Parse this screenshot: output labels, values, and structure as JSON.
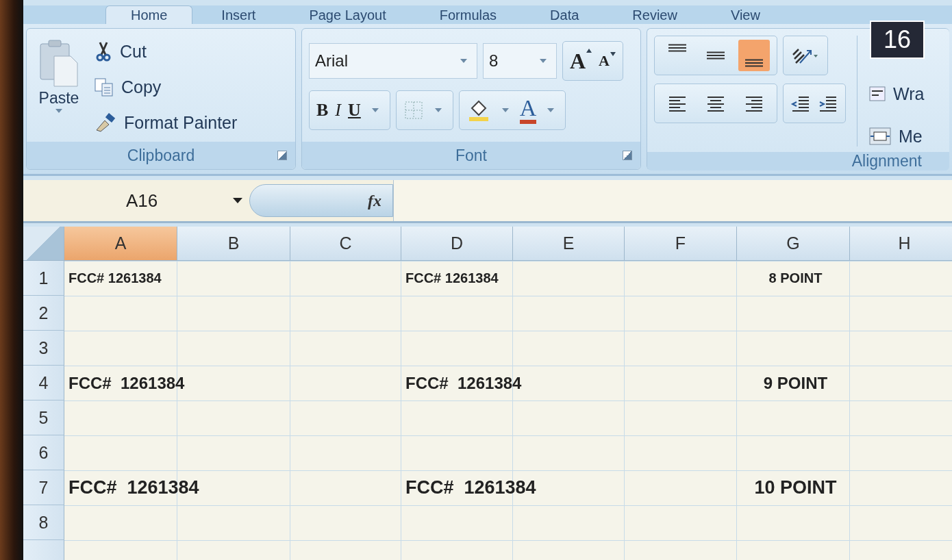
{
  "ribbon": {
    "tabs": [
      {
        "label": "Home",
        "selected": true
      },
      {
        "label": "Insert",
        "selected": false
      },
      {
        "label": "Page Layout",
        "selected": false
      },
      {
        "label": "Formulas",
        "selected": false
      },
      {
        "label": "Data",
        "selected": false
      },
      {
        "label": "Review",
        "selected": false
      },
      {
        "label": "View",
        "selected": false
      }
    ],
    "clipboard": {
      "label": "Clipboard",
      "paste": "Paste",
      "items": [
        {
          "kind": "cut",
          "label": "Cut"
        },
        {
          "kind": "copy",
          "label": "Copy"
        },
        {
          "kind": "painter",
          "label": "Format Painter"
        }
      ]
    },
    "font": {
      "label": "Font",
      "font_name": "Arial",
      "font_size": "8",
      "grow": "A",
      "shrink": "A",
      "bold": "B",
      "italic": "I",
      "underline": "U",
      "font_color": "A"
    },
    "alignment": {
      "label": "Alignment",
      "vertical": [
        {
          "kind": "top",
          "selected": false
        },
        {
          "kind": "middle",
          "selected": false
        },
        {
          "kind": "bottom",
          "selected": true
        }
      ],
      "horizontal": [
        {
          "kind": "left"
        },
        {
          "kind": "center"
        },
        {
          "kind": "right"
        }
      ],
      "wrap_text": "Wra",
      "merge": "Me"
    }
  },
  "formula_bar": {
    "name_box": "A16",
    "fx": "fx"
  },
  "sheet": {
    "columns": [
      {
        "label": "A",
        "selected": true
      },
      {
        "label": "B",
        "selected": false
      },
      {
        "label": "C",
        "selected": false
      },
      {
        "label": "D",
        "selected": false
      },
      {
        "label": "E",
        "selected": false
      },
      {
        "label": "F",
        "selected": false
      },
      {
        "label": "G",
        "selected": false
      },
      {
        "label": "H",
        "selected": false
      }
    ],
    "rows": [
      {
        "label": "1",
        "cells": {
          "A": {
            "text": "FCC# 1261384",
            "kind": "spill"
          },
          "D": {
            "text": "FCC# 1261384",
            "kind": "spill"
          },
          "G": {
            "text": "8 POINT",
            "kind": "centered"
          }
        }
      },
      {
        "label": "2"
      },
      {
        "label": "3"
      },
      {
        "label": "4",
        "cells": {
          "A": {
            "text": "FCC#  1261384",
            "kind": "spill"
          },
          "D": {
            "text": "FCC#  1261384",
            "kind": "spill"
          },
          "G": {
            "text": "9 POINT",
            "kind": "centered"
          }
        }
      },
      {
        "label": "5"
      },
      {
        "label": "6"
      },
      {
        "label": "7",
        "cells": {
          "A": {
            "text": "FCC#  1261384",
            "kind": "spill"
          },
          "D": {
            "text": "FCC#  1261384",
            "kind": "spill"
          },
          "G": {
            "text": "10 POINT",
            "kind": "centered"
          }
        }
      },
      {
        "label": "8"
      }
    ]
  },
  "badge": "16"
}
